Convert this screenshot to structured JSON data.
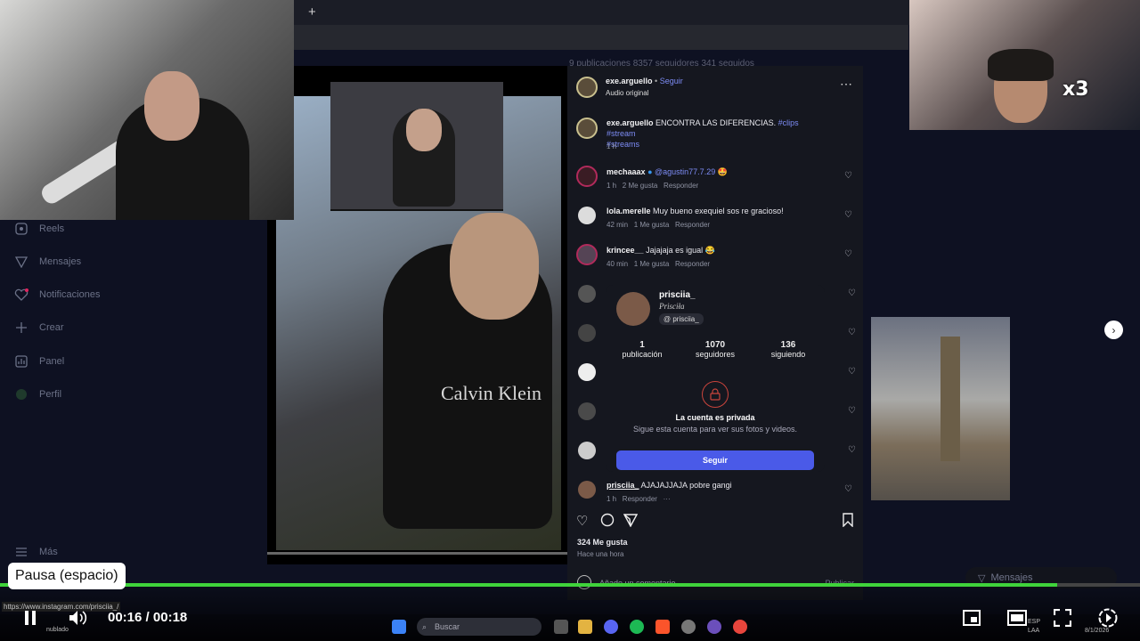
{
  "browser": {
    "new_tab": "+"
  },
  "profile_stats": "9 publicaciones   8357 seguidores   341 seguidos",
  "nav": [
    {
      "label": "Reels",
      "icon": "reels-icon"
    },
    {
      "label": "Mensajes",
      "icon": "messages-icon"
    },
    {
      "label": "Notificaciones",
      "icon": "heart-icon"
    },
    {
      "label": "Crear",
      "icon": "plus-icon"
    },
    {
      "label": "Panel",
      "icon": "chart-icon"
    },
    {
      "label": "Perfil",
      "icon": "profile-icon"
    },
    {
      "label": "Más",
      "icon": "menu-icon"
    }
  ],
  "video": {
    "brand_text": "Calvin Klein"
  },
  "post": {
    "author": "exe.arguello",
    "follow": "Seguir",
    "audio": "Audio original",
    "caption_user": "exe.arguello",
    "caption": "ENCONTRA LAS DIFERENCIAS.",
    "hashtags_line1": "#clips #stream",
    "hashtags_line2": "#streams",
    "caption_time": "1 h"
  },
  "comments": [
    {
      "user": "mechaaax",
      "mention": "@agustin77.7.29",
      "text": "",
      "emoji": "🤩",
      "time": "1 h",
      "likes": "2 Me gusta",
      "reply": "Responder"
    },
    {
      "user": "lola.merelle",
      "mention": "",
      "text": "Muy bueno exequiel sos re gracioso!",
      "emoji": "",
      "time": "42 min",
      "likes": "1 Me gusta",
      "reply": "Responder"
    },
    {
      "user": "krincee__",
      "mention": "",
      "text": "Jajajaja es igual",
      "emoji": "😂",
      "time": "40 min",
      "likes": "1 Me gusta",
      "reply": "Responder"
    }
  ],
  "last_comment": {
    "user": "prisciia_",
    "text": "AJAJAJJAJA pobre gangi",
    "time": "1 h",
    "reply": "Responder",
    "more": "···"
  },
  "hover_card": {
    "username": "prisciia_",
    "display_name": "Prisciła",
    "threads_badge": "prisciia_",
    "stats": [
      {
        "value": "1",
        "label": "publicación"
      },
      {
        "value": "1070",
        "label": "seguidores"
      },
      {
        "value": "136",
        "label": "siguiendo"
      }
    ],
    "private_title": "La cuenta es privada",
    "private_sub": "Sigue esta cuenta para ver sus fotos y videos.",
    "follow_button": "Seguir"
  },
  "post_footer": {
    "likes": "324 Me gusta",
    "time": "Hace una hora",
    "comment_placeholder": "Añade un comentario...",
    "publish": "Publicar"
  },
  "overlay": {
    "x3": "x3"
  },
  "messages_pill": "Mensajes",
  "player": {
    "tooltip": "Pausa (espacio)",
    "current_time": "00:16",
    "separator": "/",
    "duration": "00:18",
    "progress": 0.927
  },
  "status_url": "https://www.instagram.com/prisciia_/",
  "taskbar": {
    "search": "Buscar",
    "weather": "nublado",
    "lang": "ESP",
    "lang2": "LAA",
    "date": "8/1/2026"
  }
}
